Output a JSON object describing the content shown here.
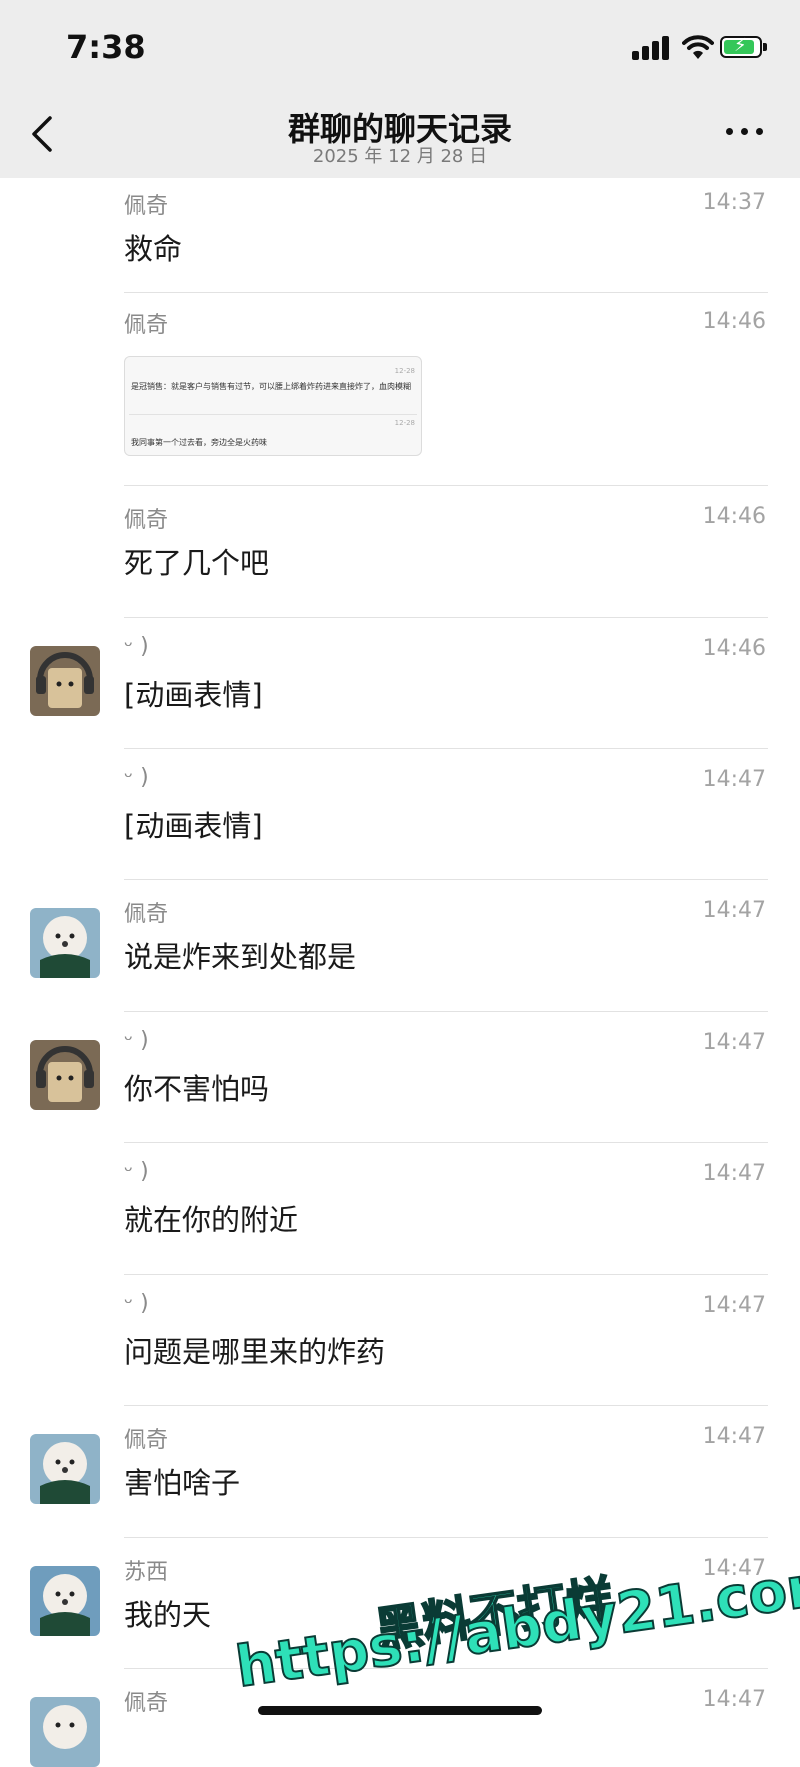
{
  "status_bar": {
    "time": "7:38"
  },
  "nav": {
    "title": "群聊的聊天记录",
    "subtitle": "2025 年 12 月 28 日"
  },
  "messages": [
    {
      "sender": "佩奇",
      "time": "14:37",
      "text": "救命",
      "avatar": "none"
    },
    {
      "sender": "佩奇",
      "time": "14:46",
      "text": "",
      "avatar": "none",
      "image": {
        "line1": "是冠销售：就是客户与销售有过节，可以腰上绑着炸药进来直接炸了，血肉模糊",
        "line2": "我同事第一个过去看，旁边全是火药味",
        "meta": "12-28"
      }
    },
    {
      "sender": "佩奇",
      "time": "14:46",
      "text": "死了几个吧",
      "avatar": "none"
    },
    {
      "sender": "ᵕ )",
      "time": "14:46",
      "text": "[动画表情]",
      "avatar": "bear"
    },
    {
      "sender": "ᵕ )",
      "time": "14:47",
      "text": "[动画表情]",
      "avatar": "none"
    },
    {
      "sender": "佩奇",
      "time": "14:47",
      "text": "说是炸来到处都是",
      "avatar": "dog"
    },
    {
      "sender": "ᵕ )",
      "time": "14:47",
      "text": "你不害怕吗",
      "avatar": "bear"
    },
    {
      "sender": "ᵕ )",
      "time": "14:47",
      "text": "就在你的附近",
      "avatar": "none"
    },
    {
      "sender": "ᵕ )",
      "time": "14:47",
      "text": "问题是哪里来的炸药",
      "avatar": "none"
    },
    {
      "sender": "佩奇",
      "time": "14:47",
      "text": "害怕啥子",
      "avatar": "dog"
    },
    {
      "sender": "苏西",
      "time": "14:47",
      "text": "我的天",
      "avatar": "dog"
    },
    {
      "sender": "佩奇",
      "time": "14:47",
      "text": "",
      "avatar": "dog"
    }
  ],
  "watermark": {
    "line1": "黑料不打烊",
    "line2": "https://abdy21.com"
  },
  "colors": {
    "nav_bg": "#ededed",
    "battery": "#34c759",
    "watermark": "#2ee0b8"
  }
}
